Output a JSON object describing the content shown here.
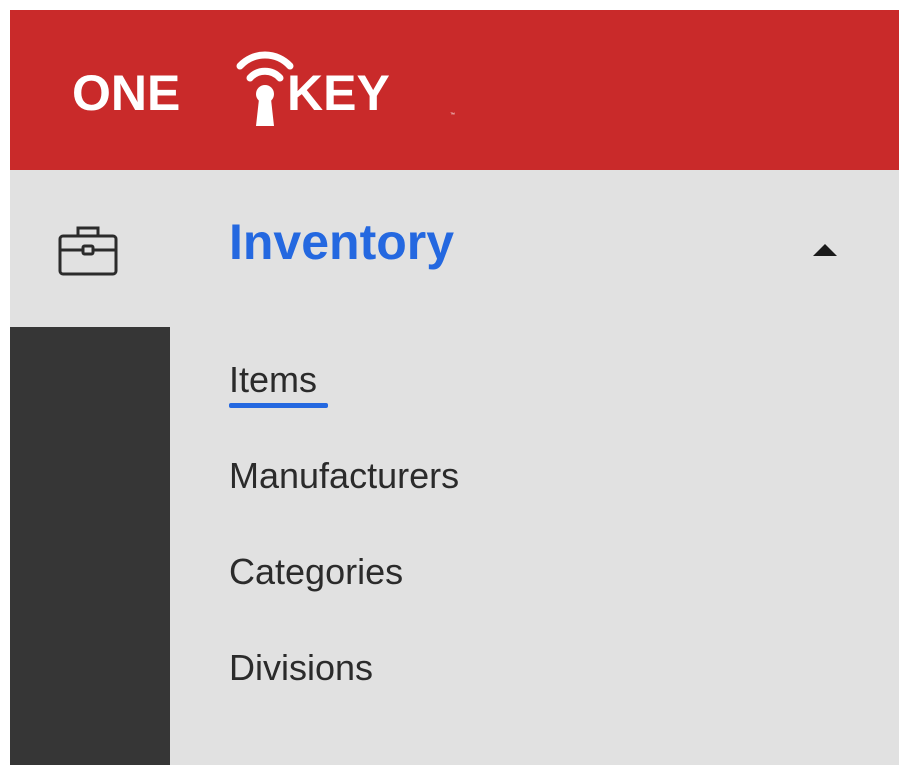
{
  "header": {
    "logo_text": "ONE KEY",
    "brand_color": "#c92a2a"
  },
  "nav": {
    "section": {
      "label": "Inventory",
      "icon": "toolbox-icon",
      "expanded": true,
      "accent_color": "#2468e0"
    },
    "items": [
      {
        "label": "Items",
        "active": true
      },
      {
        "label": "Manufacturers",
        "active": false
      },
      {
        "label": "Categories",
        "active": false
      },
      {
        "label": "Divisions",
        "active": false
      }
    ]
  }
}
